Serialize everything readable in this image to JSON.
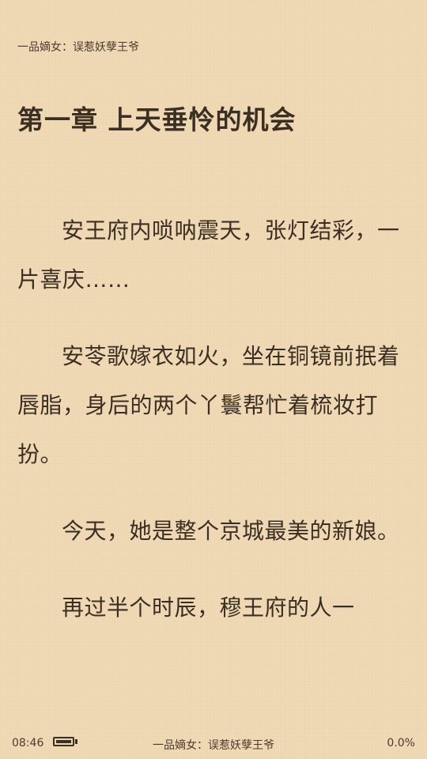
{
  "header": {
    "book_title": "一品嫡女：误惹妖孽王爷"
  },
  "chapter": {
    "title": "第一章  上天垂怜的机会"
  },
  "content": {
    "paragraphs": [
      "安王府内唢呐震天，张灯结彩，一片喜庆……",
      "安苓歌嫁衣如火，坐在铜镜前抿着唇脂，身后的两个丫鬟帮忙着梳妆打扮。",
      "今天，她是整个京城最美的新娘。",
      "再过半个时辰，穆王府的人一"
    ]
  },
  "status_bar": {
    "time": "08:46",
    "battery_icon": "battery-full-icon",
    "book_title": "一品嫡女：误惹妖孽王爷",
    "progress": "0.0%"
  },
  "theme": {
    "background": "#f0d9b5",
    "text": "#3b2e22"
  }
}
